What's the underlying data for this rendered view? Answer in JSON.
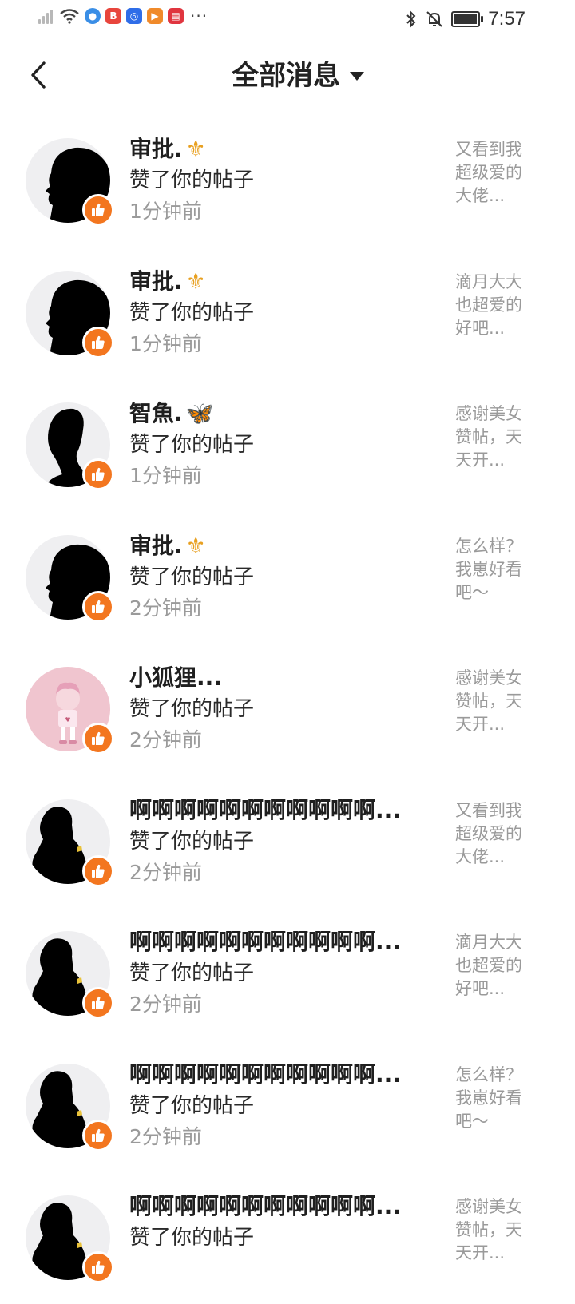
{
  "status_bar": {
    "time": "7:57",
    "more": "···",
    "icons": [
      "signal-off-icon",
      "wifi-icon",
      "browser-icon",
      "video-app-icon",
      "idea-app-icon",
      "play-app-icon",
      "book-app-icon",
      "bluetooth-icon",
      "mute-icon",
      "battery-icon"
    ]
  },
  "header": {
    "back_icon": "back-arrow-icon",
    "title": "全部消息",
    "dropdown_icon": "caret-down-icon"
  },
  "colors": {
    "accent": "#f3761f",
    "text_primary": "#1f1f1f",
    "text_secondary": "#9a9a9a"
  },
  "messages": [
    {
      "name": "审批.",
      "emoji": "⚜",
      "action": "赞了你的帖子",
      "time": "1分钟前",
      "preview": "又看到我超级爱的大佬...",
      "avatar": "silhouette-profile"
    },
    {
      "name": "审批.",
      "emoji": "⚜",
      "action": "赞了你的帖子",
      "time": "1分钟前",
      "preview": "滴月大大也超爱的好吧...",
      "avatar": "silhouette-profile"
    },
    {
      "name": "智魚.",
      "emoji": "🦋",
      "action": "赞了你的帖子",
      "time": "1分钟前",
      "preview": "感谢美女赞帖，天天开...",
      "avatar": "silhouette-side"
    },
    {
      "name": "审批.",
      "emoji": "⚜",
      "action": "赞了你的帖子",
      "time": "2分钟前",
      "preview": "怎么样？我崽好看吧～",
      "avatar": "silhouette-profile"
    },
    {
      "name": "小狐狸...",
      "emoji": "",
      "action": "赞了你的帖子",
      "time": "2分钟前",
      "preview": "感谢美女赞帖，天天开...",
      "avatar": "pink-character"
    },
    {
      "name": "啊啊啊啊啊啊啊啊啊啊啊...",
      "emoji": "",
      "action": "赞了你的帖子",
      "time": "2分钟前",
      "preview": "又看到我超级爱的大佬...",
      "avatar": "silhouette-sitting"
    },
    {
      "name": "啊啊啊啊啊啊啊啊啊啊啊...",
      "emoji": "",
      "action": "赞了你的帖子",
      "time": "2分钟前",
      "preview": "滴月大大也超爱的好吧...",
      "avatar": "silhouette-sitting"
    },
    {
      "name": "啊啊啊啊啊啊啊啊啊啊啊...",
      "emoji": "",
      "action": "赞了你的帖子",
      "time": "2分钟前",
      "preview": "怎么样？我崽好看吧～",
      "avatar": "silhouette-sitting"
    },
    {
      "name": "啊啊啊啊啊啊啊啊啊啊啊...",
      "emoji": "",
      "action": "赞了你的帖子",
      "time": "",
      "preview": "感谢美女赞帖，天天开...",
      "avatar": "silhouette-sitting"
    }
  ]
}
